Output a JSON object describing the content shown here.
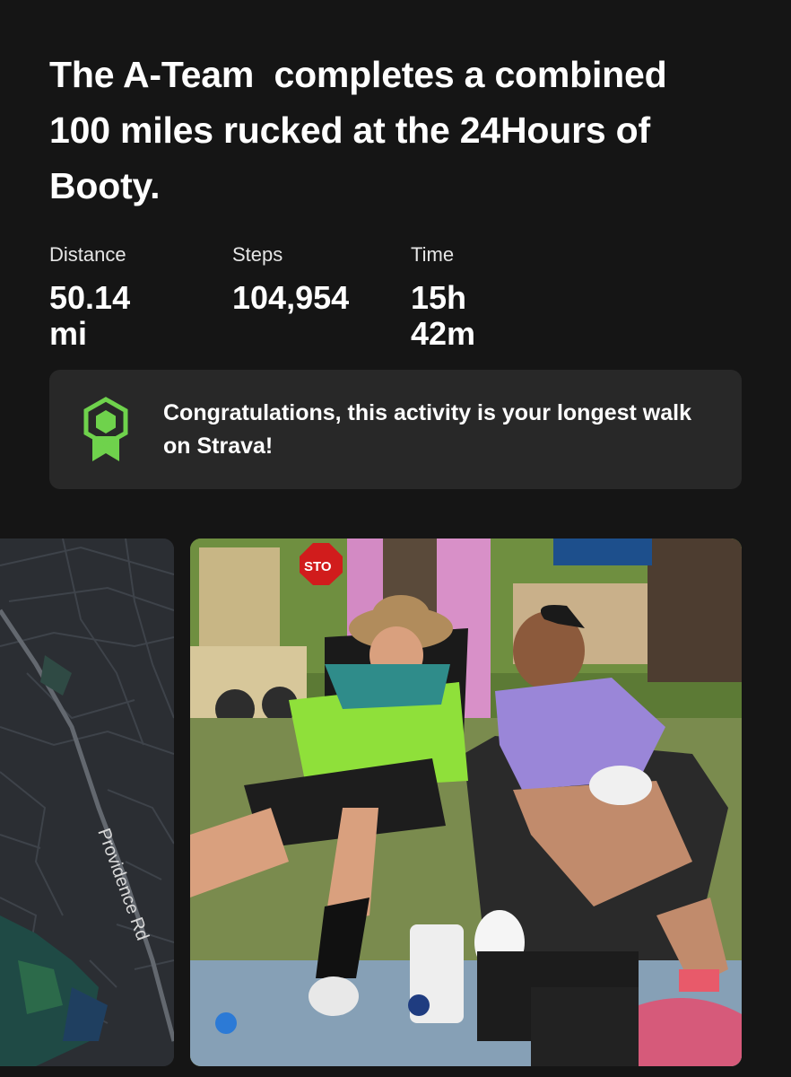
{
  "activity": {
    "title": "The A-Team  completes a combined 100 miles rucked at the 24Hours of Booty."
  },
  "stats": [
    {
      "label": "Distance",
      "value": "50.14 mi"
    },
    {
      "label": "Steps",
      "value": "104,954"
    },
    {
      "label": "Time",
      "value": "15h 42m"
    }
  ],
  "achievement": {
    "message": "Congratulations, this activity is your longest walk on Strava!",
    "icon": "achievement-badge-icon",
    "accent_color": "#6fd24c"
  },
  "map": {
    "road_label": "Providence Rd"
  },
  "photo": {
    "sign_text": "STO",
    "description_icon": "activity-photo"
  }
}
